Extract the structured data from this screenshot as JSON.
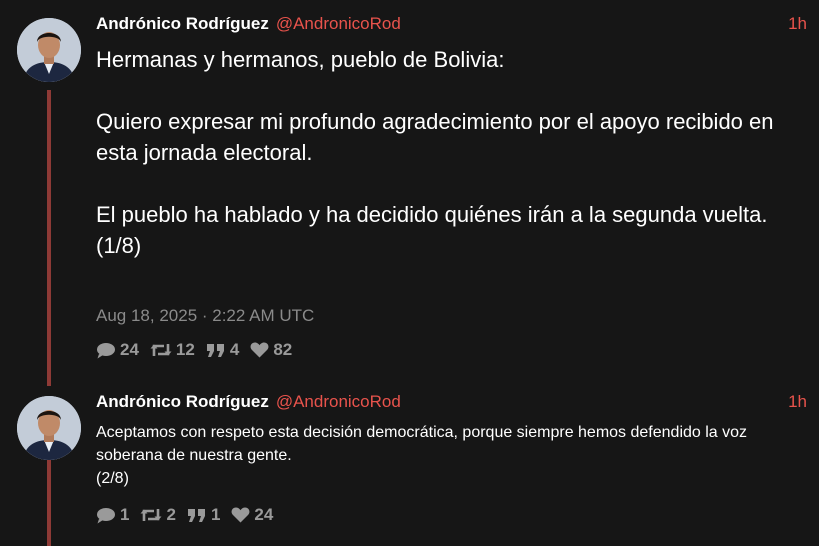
{
  "tweets": [
    {
      "author_name": "Andrónico Rodríguez",
      "author_handle": "@AndronicoRod",
      "time": "1h",
      "text": "Hermanas y hermanos, pueblo de Bolivia:\n\nQuiero expresar mi profundo agradecimiento por el apoyo recibido en esta jornada electoral.\n\nEl pueblo ha hablado y ha decidido quiénes irán a la segunda vuelta.\n(1/8)",
      "date": "Aug 18, 2025 · 2:22 AM UTC",
      "stats": {
        "replies": "24",
        "retweets": "12",
        "quotes": "4",
        "likes": "82"
      }
    },
    {
      "author_name": "Andrónico Rodríguez",
      "author_handle": "@AndronicoRod",
      "time": "1h",
      "text": "Aceptamos con respeto esta decisión democrática, porque siempre hemos defendido la voz soberana de nuestra gente.\n(2/8)",
      "stats": {
        "replies": "1",
        "retweets": "2",
        "quotes": "1",
        "likes": "24"
      }
    }
  ],
  "icons": {
    "reply": "comment-icon",
    "retweet": "retweet-icon",
    "quote": "quote-icon",
    "like": "heart-icon"
  },
  "colors": {
    "background": "#161616",
    "accent": "#e8534c",
    "thread_line": "#8e3a36",
    "muted": "#9a9a9a"
  }
}
